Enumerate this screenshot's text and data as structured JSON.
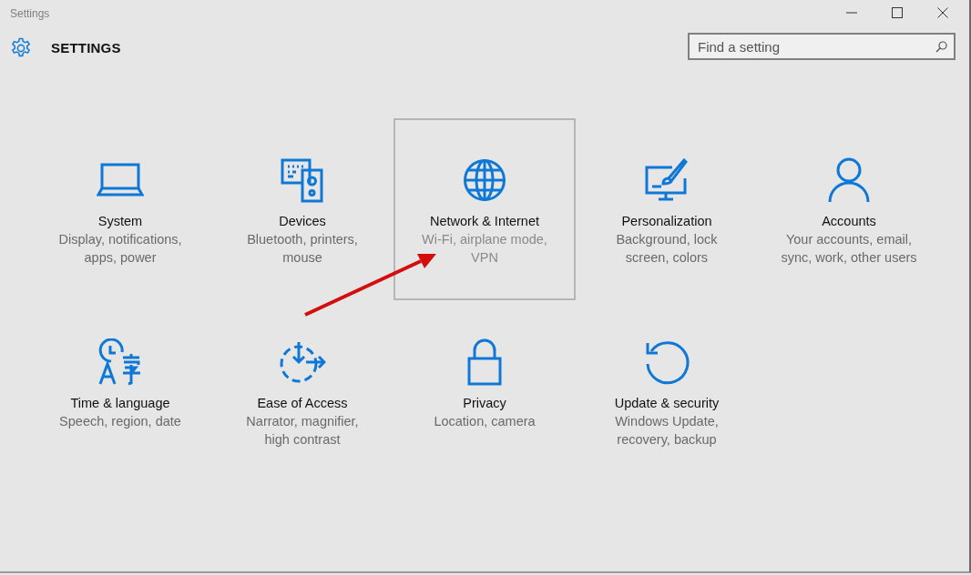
{
  "window": {
    "title": "Settings"
  },
  "header": {
    "title": "SETTINGS"
  },
  "search": {
    "placeholder": "Find a setting"
  },
  "categories": [
    {
      "title": "System",
      "description": "Display, notifications, apps, power",
      "selected": false
    },
    {
      "title": "Devices",
      "description": "Bluetooth, printers, mouse",
      "selected": false
    },
    {
      "title": "Network & Internet",
      "description": "Wi-Fi, airplane mode, VPN",
      "selected": true
    },
    {
      "title": "Personalization",
      "description": "Background, lock screen, colors",
      "selected": false
    },
    {
      "title": "Accounts",
      "description": "Your accounts, email, sync, work, other users",
      "selected": false
    },
    {
      "title": "Time & language",
      "description": "Speech, region, date",
      "selected": false
    },
    {
      "title": "Ease of Access",
      "description": "Narrator, magnifier, high contrast",
      "selected": false
    },
    {
      "title": "Privacy",
      "description": "Location, camera",
      "selected": false
    },
    {
      "title": "Update & security",
      "description": "Windows Update, recovery, backup",
      "selected": false
    }
  ]
}
